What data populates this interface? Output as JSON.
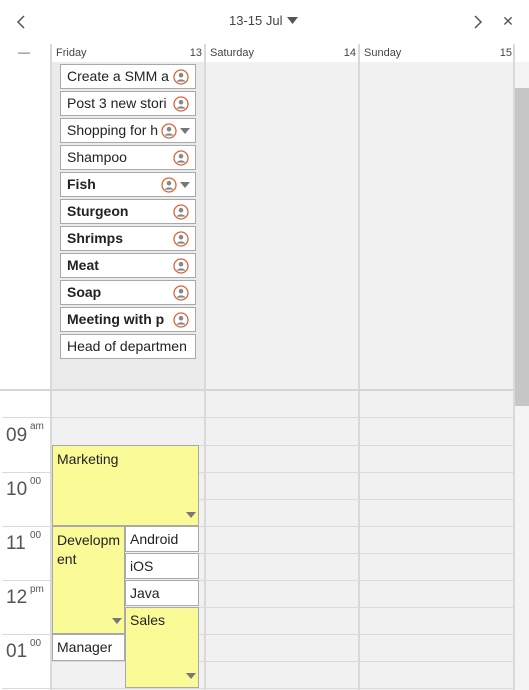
{
  "header": {
    "date_range": "13-15 Jul",
    "prev_icon": "chevron-left-icon",
    "next_icon": "chevron-right-icon",
    "close_label": "✕",
    "collapse_label": "—"
  },
  "days": [
    {
      "name": "Friday",
      "date": "13"
    },
    {
      "name": "Saturday",
      "date": "14"
    },
    {
      "name": "Sunday",
      "date": "15"
    }
  ],
  "all_day_tasks": [
    {
      "label": "Create a SMM a",
      "bold": false,
      "assigned": true,
      "dropdown": false
    },
    {
      "label": "Post 3 new stori",
      "bold": false,
      "assigned": true,
      "dropdown": false
    },
    {
      "label": "Shopping for h",
      "bold": false,
      "assigned": true,
      "dropdown": true
    },
    {
      "label": "Shampoo",
      "bold": false,
      "assigned": true,
      "dropdown": false
    },
    {
      "label": "Fish",
      "bold": true,
      "assigned": true,
      "dropdown": true
    },
    {
      "label": "Sturgeon",
      "bold": true,
      "assigned": true,
      "dropdown": false
    },
    {
      "label": "Shrimps",
      "bold": true,
      "assigned": true,
      "dropdown": false
    },
    {
      "label": "Meat",
      "bold": true,
      "assigned": true,
      "dropdown": false
    },
    {
      "label": "Soap",
      "bold": true,
      "assigned": true,
      "dropdown": false
    },
    {
      "label": "Meeting with p",
      "bold": true,
      "assigned": true,
      "dropdown": false
    },
    {
      "label": "Head of departmen",
      "bold": false,
      "assigned": false,
      "dropdown": false
    }
  ],
  "time_labels": [
    {
      "hour": "09",
      "suffix": "am"
    },
    {
      "hour": "10",
      "suffix": "00"
    },
    {
      "hour": "11",
      "suffix": "00"
    },
    {
      "hour": "12",
      "suffix": "pm"
    },
    {
      "hour": "01",
      "suffix": "00"
    }
  ],
  "appointments": [
    {
      "label": "Marketing",
      "color": "#fafa96"
    },
    {
      "label": "Development",
      "color": "#fafa96"
    },
    {
      "label": "Android",
      "color": "#ffffff"
    },
    {
      "label": "iOS",
      "color": "#ffffff"
    },
    {
      "label": "Java",
      "color": "#ffffff"
    },
    {
      "label": "Sales",
      "color": "#fafa96"
    },
    {
      "label": "Manager",
      "color": "#ffffff"
    }
  ],
  "colors": {
    "assignee_icon": "#d9643a",
    "appointment_yellow": "#fafa96"
  }
}
